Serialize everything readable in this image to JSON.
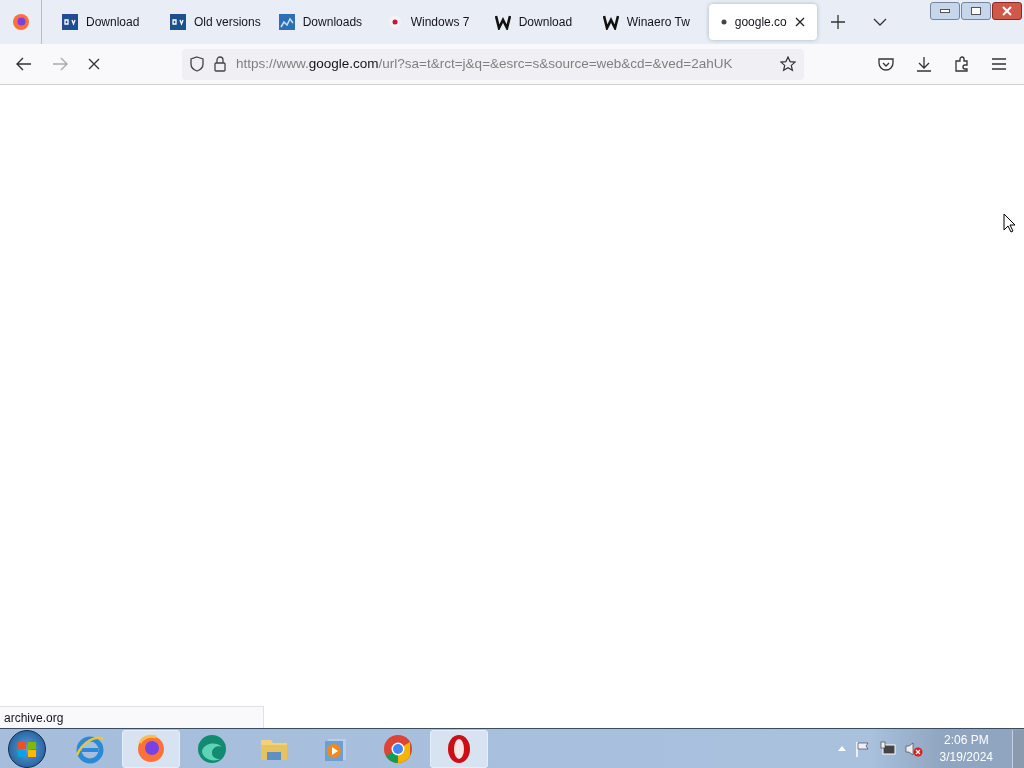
{
  "tabs": [
    {
      "title": "Download",
      "kind": "ov",
      "selected": false
    },
    {
      "title": "Old versions",
      "kind": "ov",
      "selected": false
    },
    {
      "title": "Downloads",
      "kind": "chart",
      "selected": false
    },
    {
      "title": "Windows 7",
      "kind": "dot",
      "selected": false
    },
    {
      "title": "Download",
      "kind": "w",
      "selected": false
    },
    {
      "title": "Winaero Tw",
      "kind": "w",
      "selected": false
    },
    {
      "title": "google.co",
      "kind": "loading",
      "selected": true
    }
  ],
  "address": {
    "prefix": "https://www.",
    "host": "google.com",
    "path": "/url?sa=t&rct=j&q=&esrc=s&source=web&cd=&ved=2ahUK"
  },
  "status_text": "archive.org",
  "taskbar": {
    "apps": [
      {
        "kind": "ie",
        "selected": false
      },
      {
        "kind": "firefox",
        "selected": true
      },
      {
        "kind": "edge",
        "selected": false
      },
      {
        "kind": "folder",
        "selected": false
      },
      {
        "kind": "media",
        "selected": false
      },
      {
        "kind": "chrome",
        "selected": false
      },
      {
        "kind": "opera",
        "selected": true
      }
    ],
    "time": "2:06 PM",
    "date": "3/19/2024"
  }
}
